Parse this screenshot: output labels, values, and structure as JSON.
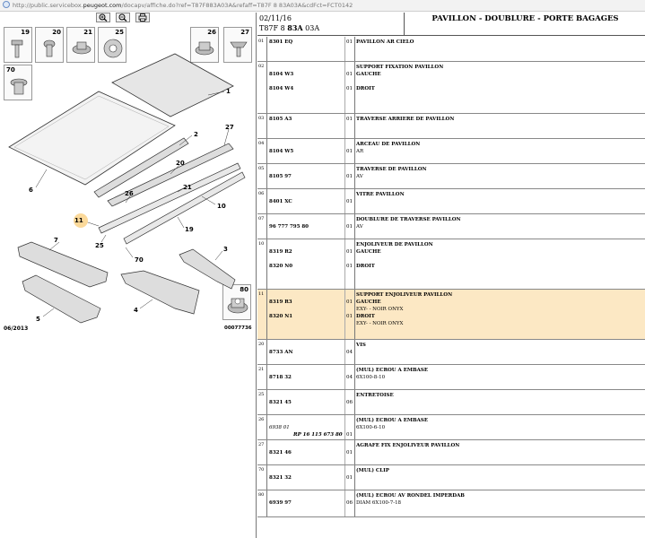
{
  "browser": {
    "url_prefix": "http://public.servicebox.",
    "url_domain": "peugeot.com",
    "url_rest": "/docapv/affiche.do?ref=T87F883A03A&refaff=T87F 8 83A03A&cdFct=FCT0142"
  },
  "illustration": {
    "date": "06/2013",
    "ref": "00077736",
    "box_labels": [
      "19",
      "20",
      "21",
      "25",
      "26",
      "27",
      "70",
      "80"
    ],
    "callouts": [
      "1",
      "2",
      "27",
      "20",
      "26",
      "21",
      "6",
      "11",
      "10",
      "25",
      "19",
      "70",
      "7",
      "3",
      "4",
      "5"
    ]
  },
  "header": {
    "date": "02/11/16",
    "code_prefix": "T87F 8 ",
    "code_bold": "83A",
    "code_suffix": " 03A",
    "title": "PAVILLON - DOUBLURE - PORTE BAGAGES"
  },
  "parts": [
    {
      "num": "01",
      "h": 28,
      "lines": [
        {
          "ref": "8301 EQ",
          "qty": "01",
          "desc": "PAVILLON AR CIELO"
        }
      ]
    },
    {
      "num": "02",
      "h": 58,
      "lines": [
        {
          "ref": "",
          "qty": "",
          "desc": "SUPPORT FIXATION PAVILLON"
        },
        {
          "ref": "8104 W3",
          "qty": "01",
          "desc": "GAUCHE"
        },
        {
          "ref": "",
          "qty": "",
          "desc": ""
        },
        {
          "ref": "8104 W4",
          "qty": "01",
          "desc": "DROIT"
        }
      ]
    },
    {
      "num": "03",
      "h": 28,
      "lines": [
        {
          "ref": "8105 A3",
          "qty": "01",
          "desc": "TRAVERSE ARRIERE DE PAVILLON"
        }
      ]
    },
    {
      "num": "04",
      "h": 28,
      "lines": [
        {
          "ref": "",
          "qty": "",
          "desc": "ARCEAU DE PAVILLON"
        },
        {
          "ref": "8104 W5",
          "qty": "01",
          "desc": "AR",
          "plain": true
        }
      ]
    },
    {
      "num": "05",
      "h": 28,
      "lines": [
        {
          "ref": "",
          "qty": "",
          "desc": "TRAVERSE DE PAVILLON"
        },
        {
          "ref": "8105 97",
          "qty": "01",
          "desc": "AV",
          "plain": true
        }
      ]
    },
    {
      "num": "06",
      "h": 28,
      "lines": [
        {
          "ref": "",
          "qty": "",
          "desc": "VITRE PAVILLON"
        },
        {
          "ref": "8401 XC",
          "qty": "01",
          "desc": ""
        }
      ]
    },
    {
      "num": "07",
      "h": 28,
      "lines": [
        {
          "ref": "",
          "qty": "",
          "desc": "DOUBLURE DE TRAVERSE PAVILLON"
        },
        {
          "ref": "96 777 795 80",
          "qty": "01",
          "desc": "AV",
          "plain": true
        }
      ]
    },
    {
      "num": "10",
      "h": 56,
      "lines": [
        {
          "ref": "",
          "qty": "",
          "desc": "ENJOLIVEUR DE PAVILLON"
        },
        {
          "ref": "8319 R2",
          "qty": "01",
          "desc": "GAUCHE"
        },
        {
          "ref": "",
          "qty": "",
          "desc": ""
        },
        {
          "ref": "8320 N0",
          "qty": "01",
          "desc": "DROIT"
        }
      ]
    },
    {
      "num": "11",
      "h": 56,
      "highlight": true,
      "lines": [
        {
          "ref": "",
          "qty": "",
          "desc": "SUPPORT ENJOLIVEUR PAVILLON"
        },
        {
          "ref": "8319 R3",
          "qty": "01",
          "desc": "GAUCHE"
        },
        {
          "ref": "",
          "qty": "",
          "desc": "EXY- - NOIR ONYX",
          "plain": true
        },
        {
          "ref": "8320 N1",
          "qty": "01",
          "desc": "DROIT"
        },
        {
          "ref": "",
          "qty": "",
          "desc": "EXY- - NOIR ONYX",
          "plain": true
        }
      ]
    },
    {
      "num": "20",
      "h": 28,
      "lines": [
        {
          "ref": "",
          "qty": "",
          "desc": "VIS"
        },
        {
          "ref": "8733 AN",
          "qty": "04",
          "desc": ""
        }
      ]
    },
    {
      "num": "21",
      "h": 28,
      "lines": [
        {
          "ref": "",
          "qty": "",
          "desc": "(MUL) ECROU A EMBASE"
        },
        {
          "ref": "8718 32",
          "qty": "04",
          "desc": "6X100-8-10",
          "plain": true
        }
      ]
    },
    {
      "num": "25",
      "h": 28,
      "lines": [
        {
          "ref": "",
          "qty": "",
          "desc": "ENTRETOISE"
        },
        {
          "ref": "8321 45",
          "qty": "06",
          "desc": ""
        }
      ]
    },
    {
      "num": "26",
      "h": 28,
      "lines": [
        {
          "ref": "",
          "qty": "",
          "desc": "(MUL) ECROU A EMBASE"
        },
        {
          "ref": "6938 01",
          "italic": true,
          "qty": "",
          "desc": "6X100-6-10",
          "plain": true
        },
        {
          "ref": "",
          "rp": "RP 16 115 673 80",
          "qty": "01",
          "desc": ""
        }
      ]
    },
    {
      "num": "27",
      "h": 28,
      "lines": [
        {
          "ref": "",
          "qty": "",
          "desc": "AGRAFE FIX ENJOLIVEUR PAVILLON"
        },
        {
          "ref": "8321 46",
          "qty": "01",
          "desc": ""
        }
      ]
    },
    {
      "num": "70",
      "h": 28,
      "lines": [
        {
          "ref": "",
          "qty": "",
          "desc": "(MUL) CLIP"
        },
        {
          "ref": "8321 32",
          "qty": "01",
          "desc": ""
        }
      ]
    },
    {
      "num": "80",
      "h": 30,
      "lines": [
        {
          "ref": "",
          "qty": "",
          "desc": "(MUL) ECROU AV RONDEL IMPERDAB"
        },
        {
          "ref": "6939 97",
          "qty": "06",
          "desc": "DIAM 6X100-7-18",
          "plain": true
        }
      ]
    }
  ]
}
